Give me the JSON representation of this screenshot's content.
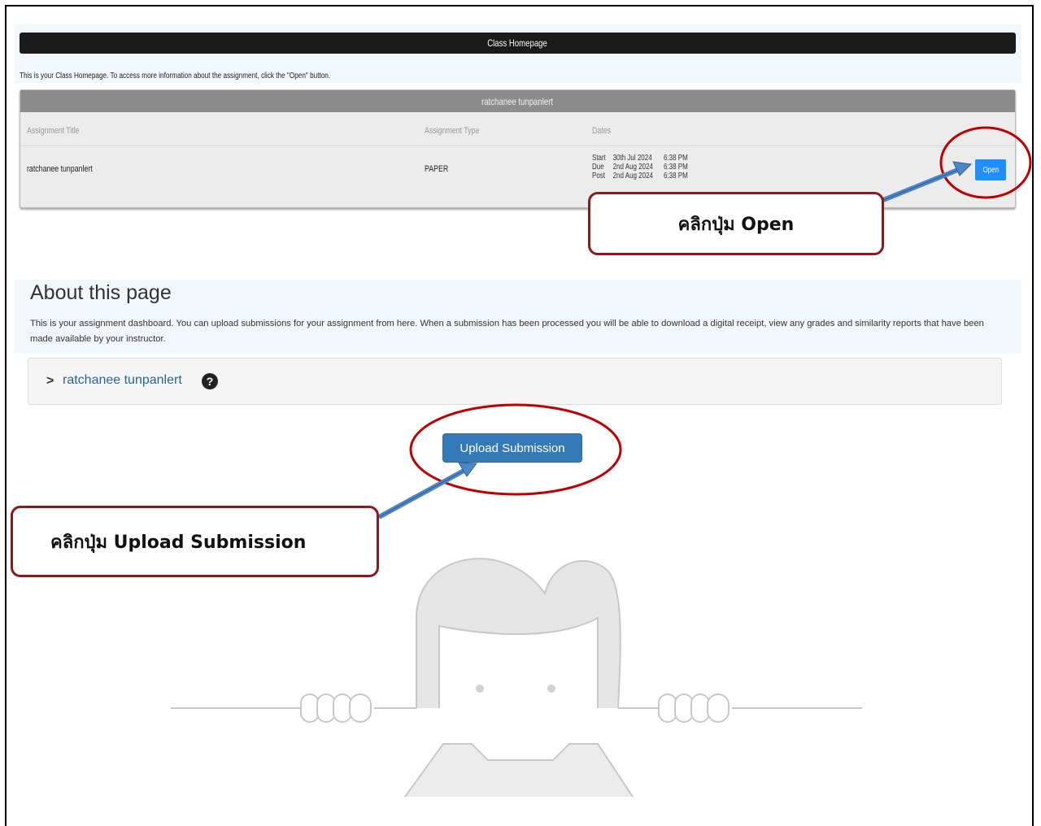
{
  "class_homepage": {
    "header_title": "Class Homepage",
    "intro_text": "This is your Class Homepage. To access more information about the assignment, click the \"Open\" button.",
    "panel_title": "ratchanee tunpanlert",
    "columns": [
      "Assignment Title",
      "Assignment Type",
      "Dates"
    ],
    "row": {
      "title": "ratchanee tunpanlert",
      "type": "PAPER",
      "dates": [
        {
          "label": "Start",
          "date": "30th Jul 2024",
          "time": "6:38 PM"
        },
        {
          "label": "Due",
          "date": "2nd Aug 2024",
          "time": "6:38 PM"
        },
        {
          "label": "Post",
          "date": "2nd Aug 2024",
          "time": "6:38 PM"
        }
      ],
      "open_label": "Open"
    }
  },
  "about": {
    "title": "About this page",
    "description": "This is your assignment dashboard. You can upload submissions for your assignment from here. When a submission has been processed you will be able to download a digital receipt, view any grades and similarity reports that have been made available by your instructor.",
    "accordion_chevron": ">",
    "accordion_title": "ratchanee tunpanlert",
    "help_icon": "?",
    "upload_label": "Upload Submission"
  },
  "annotations": {
    "open_callout": "คลิกปุ่ม Open",
    "upload_callout": "คลิกปุ่ม Upload Submission",
    "highlight_color": "#c00000",
    "arrow_color": "#4a86c8"
  }
}
